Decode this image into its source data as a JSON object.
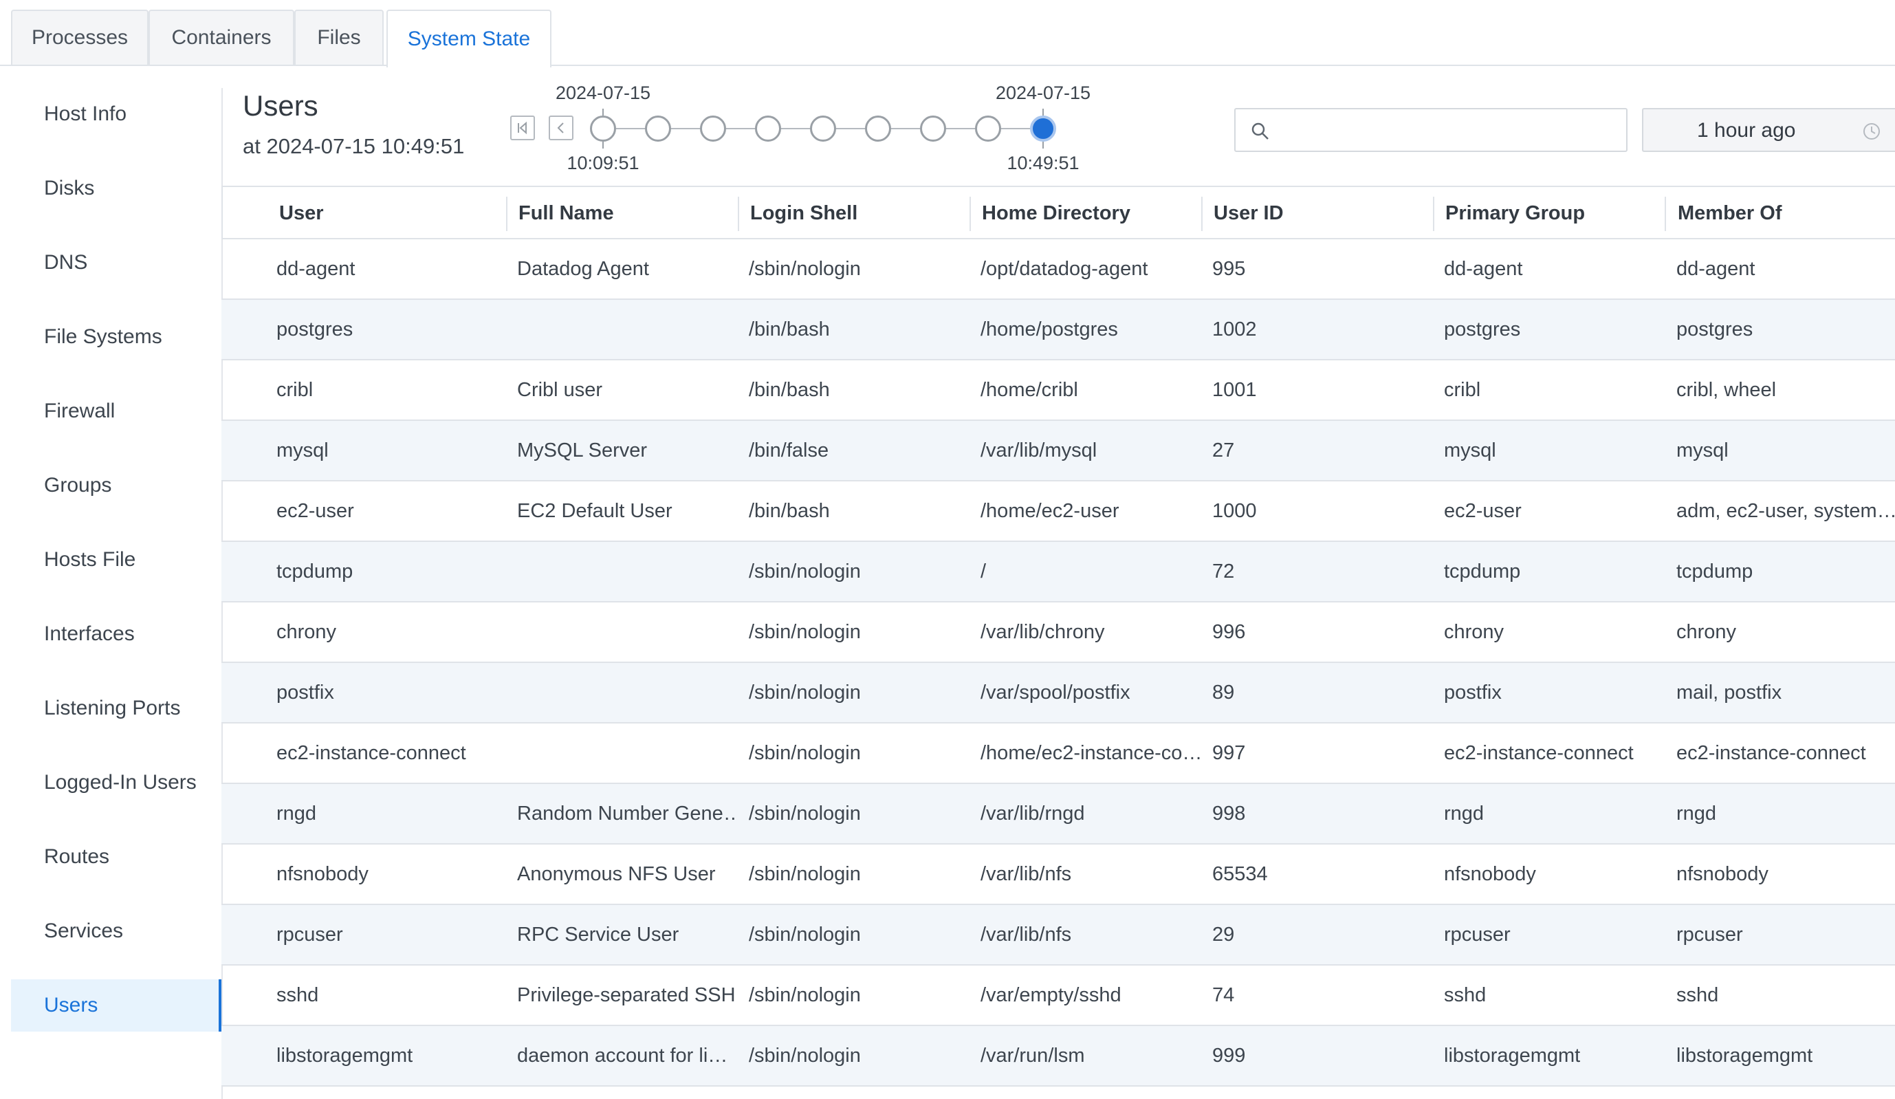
{
  "tabs": [
    {
      "label": "Processes"
    },
    {
      "label": "Containers"
    },
    {
      "label": "Files"
    },
    {
      "label": "System State",
      "active": true
    }
  ],
  "sidebar": {
    "items": [
      {
        "label": "Host Info"
      },
      {
        "label": "Disks"
      },
      {
        "label": "DNS"
      },
      {
        "label": "File Systems"
      },
      {
        "label": "Firewall"
      },
      {
        "label": "Groups"
      },
      {
        "label": "Hosts File"
      },
      {
        "label": "Interfaces"
      },
      {
        "label": "Listening Ports"
      },
      {
        "label": "Logged-In Users"
      },
      {
        "label": "Routes"
      },
      {
        "label": "Services"
      },
      {
        "label": "Users",
        "active": true
      }
    ]
  },
  "header": {
    "title": "Users",
    "subtitle": "at 2024-07-15 10:49:51"
  },
  "timeline": {
    "start_date": "2024-07-15",
    "start_time": "10:09:51",
    "end_date": "2024-07-15",
    "end_time": "10:49:51",
    "node_count": 9,
    "active_node": 8,
    "first_icon": "skip-to-start-icon",
    "prev_icon": "chevron-left-icon"
  },
  "search": {
    "placeholder": "",
    "value": "",
    "icon": "search-icon"
  },
  "time_picker": {
    "value": "1 hour ago",
    "icon": "clock-icon"
  },
  "table": {
    "columns": [
      "User",
      "Full Name",
      "Login Shell",
      "Home Directory",
      "User ID",
      "Primary Group",
      "Member Of"
    ],
    "rows": [
      [
        "dd-agent",
        "Datadog Agent",
        "/sbin/nologin",
        "/opt/datadog-agent",
        "995",
        "dd-agent",
        "dd-agent"
      ],
      [
        "postgres",
        "",
        "/bin/bash",
        "/home/postgres",
        "1002",
        "postgres",
        "postgres"
      ],
      [
        "cribl",
        "Cribl user",
        "/bin/bash",
        "/home/cribl",
        "1001",
        "cribl",
        "cribl, wheel"
      ],
      [
        "mysql",
        "MySQL Server",
        "/bin/false",
        "/var/lib/mysql",
        "27",
        "mysql",
        "mysql"
      ],
      [
        "ec2-user",
        "EC2 Default User",
        "/bin/bash",
        "/home/ec2-user",
        "1000",
        "ec2-user",
        "adm, ec2-user, system…"
      ],
      [
        "tcpdump",
        "",
        "/sbin/nologin",
        "/",
        "72",
        "tcpdump",
        "tcpdump"
      ],
      [
        "chrony",
        "",
        "/sbin/nologin",
        "/var/lib/chrony",
        "996",
        "chrony",
        "chrony"
      ],
      [
        "postfix",
        "",
        "/sbin/nologin",
        "/var/spool/postfix",
        "89",
        "postfix",
        "mail, postfix"
      ],
      [
        "ec2-instance-connect",
        "",
        "/sbin/nologin",
        "/home/ec2-instance-co…",
        "997",
        "ec2-instance-connect",
        "ec2-instance-connect"
      ],
      [
        "rngd",
        "Random Number Gene…",
        "/sbin/nologin",
        "/var/lib/rngd",
        "998",
        "rngd",
        "rngd"
      ],
      [
        "nfsnobody",
        "Anonymous NFS User",
        "/sbin/nologin",
        "/var/lib/nfs",
        "65534",
        "nfsnobody",
        "nfsnobody"
      ],
      [
        "rpcuser",
        "RPC Service User",
        "/sbin/nologin",
        "/var/lib/nfs",
        "29",
        "rpcuser",
        "rpcuser"
      ],
      [
        "sshd",
        "Privilege-separated SSH",
        "/sbin/nologin",
        "/var/empty/sshd",
        "74",
        "sshd",
        "sshd"
      ],
      [
        "libstoragemgmt",
        "daemon account for li…",
        "/sbin/nologin",
        "/var/run/lsm",
        "999",
        "libstoragemgmt",
        "libstoragemgmt"
      ]
    ]
  },
  "colors": {
    "accent": "#1a73d9",
    "active_node": "#1f6fd6",
    "row_alt": "#f2f6fa",
    "sidebar_active_bg": "#e7f3fd"
  }
}
